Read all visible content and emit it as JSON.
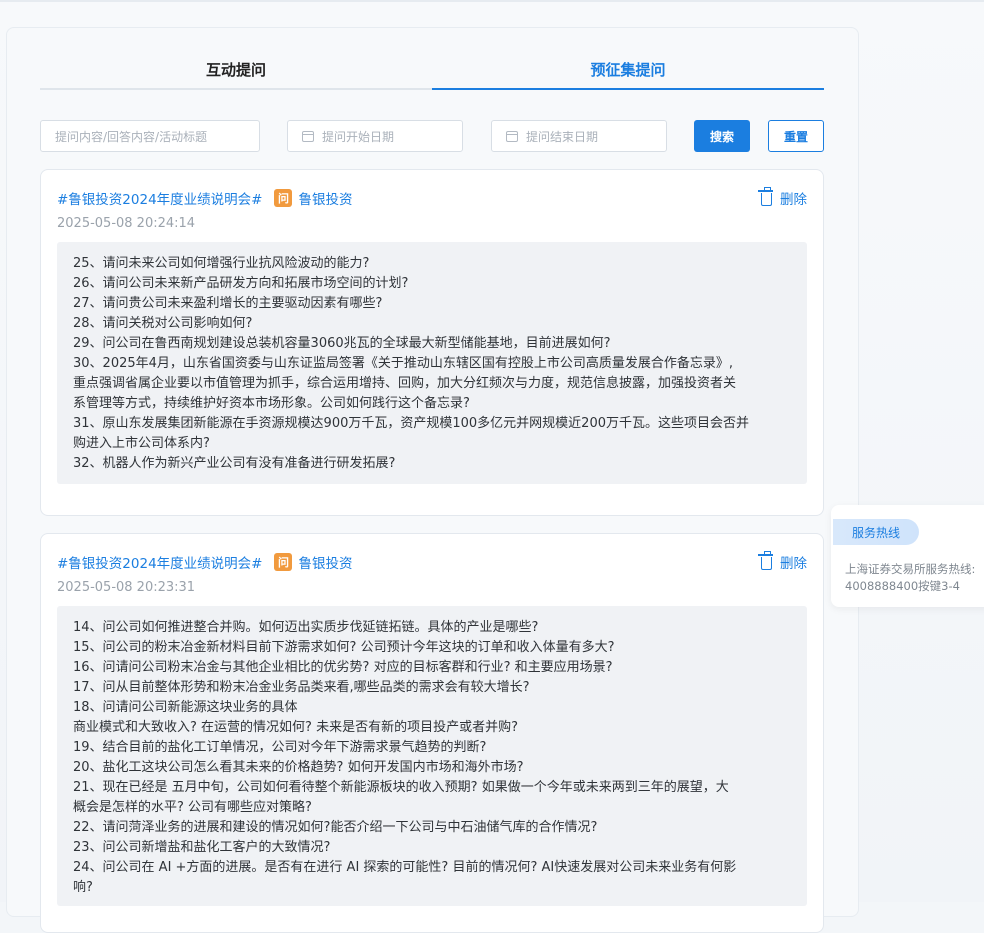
{
  "tabs": [
    "互动提问",
    "预征集提问"
  ],
  "filters": {
    "keyword_placeholder": "提问内容/回答内容/活动标题",
    "start_placeholder": "提问开始日期",
    "end_placeholder": "提问结束日期",
    "search_label": "搜索",
    "reset_label": "重置"
  },
  "cards": [
    {
      "tag": "#鲁银投资2024年度业绩说明会#",
      "badge": "问",
      "company": "鲁银投资",
      "delete_label": "删除",
      "time": "2025-05-08 20:24:14",
      "lines": [
        "25、请问未来公司如何增强行业抗风险波动的能力?",
        "26、请问公司未来新产品研发方向和拓展市场空间的计划?",
        "27、请问贵公司未来盈利增长的主要驱动因素有哪些?",
        "28、请问关税对公司影响如何?",
        "29、问公司在鲁西南规划建设总装机容量3060兆瓦的全球最大新型储能基地，目前进展如何?",
        "30、2025年4月，山东省国资委与山东证监局签署《关于推动山东辖区国有控股上市公司高质量发展合作备忘录》,",
        "重点强调省属企业要以市值管理为抓手，综合运用增持、回购，加大分红频次与力度，规范信息披露，加强投资者关",
        "系管理等方式，持续维护好资本市场形象。公司如何践行这个备忘录?",
        "31、原山东发展集团新能源在手资源规模达900万千瓦，资产规模100多亿元并网规模近200万千瓦。这些项目会否并",
        "购进入上市公司体系内?",
        "32、机器人作为新兴产业公司有没有准备进行研发拓展?"
      ]
    },
    {
      "tag": "#鲁银投资2024年度业绩说明会#",
      "badge": "问",
      "company": "鲁银投资",
      "delete_label": "删除",
      "time": "2025-05-08 20:23:31",
      "lines": [
        "14、问公司如何推进整合并购。如何迈出实质步伐延链拓链。具体的产业是哪些?",
        "15、问公司的粉末冶金新材料目前下游需求如何? 公司预计今年这块的订单和收入体量有多大?",
        "16、问请问公司粉末冶金与其他企业相比的优劣势? 对应的目标客群和行业? 和主要应用场景?",
        "17、问从目前整体形势和粉末冶金业务品类来看,哪些品类的需求会有较大增长?",
        "18、问请问公司新能源这块业务的具体",
        "商业模式和大致收入? 在运营的情况如何? 未来是否有新的项目投产或者并购?",
        "19、结合目前的盐化工订单情况，公司对今年下游需求景气趋势的判断?",
        "20、盐化工这块公司怎么看其未来的价格趋势? 如何开发国内市场和海外市场?",
        "21、现在已经是 五月中旬，公司如何看待整个新能源板块的收入预期? 如果做一个今年或未来两到三年的展望，大",
        "概会是怎样的水平? 公司有哪些应对策略?",
        "22、请问菏泽业务的进展和建设的情况如何?能否介绍一下公司与中石油储气库的合作情况?",
        "23、问公司新增盐和盐化工客户的大致情况?",
        "24、问公司在 AI +方面的进展。是否有在进行 AI 探索的可能性? 目前的情况何? AI快速发展对公司未来业务有何影",
        "响?"
      ]
    }
  ],
  "hotline": {
    "title": "服务热线",
    "line1": "上海证券交易所服务热线:",
    "line2": "4008888400按键3-4"
  }
}
